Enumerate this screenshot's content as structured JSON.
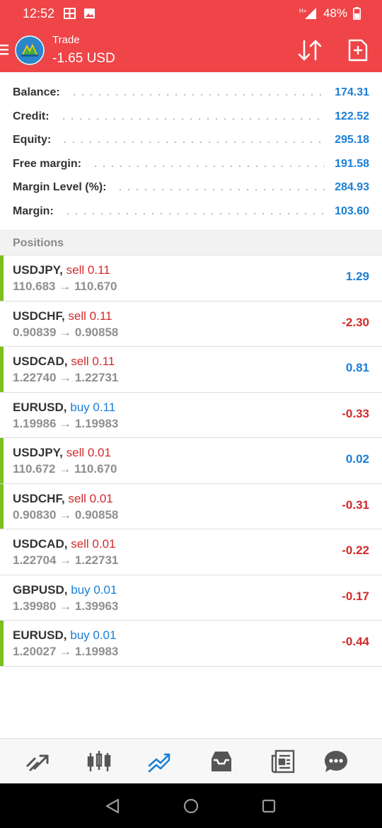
{
  "status_bar": {
    "time": "12:52",
    "network": "H+",
    "battery": "48%"
  },
  "app_bar": {
    "title": "Trade",
    "profit": "-1.65 USD"
  },
  "account": [
    {
      "label": "Balance:",
      "value": "174.31"
    },
    {
      "label": "Credit:",
      "value": "122.52"
    },
    {
      "label": "Equity:",
      "value": "295.18"
    },
    {
      "label": "Free margin:",
      "value": "191.58"
    },
    {
      "label": "Margin Level (%):",
      "value": "284.93"
    },
    {
      "label": "Margin:",
      "value": "103.60"
    }
  ],
  "positions_header": "Positions",
  "positions": [
    {
      "symbol": "USDJPY,",
      "side": "sell 0.11",
      "prices": "110.683 → 110.670",
      "profit": "1.29"
    },
    {
      "symbol": "USDCHF,",
      "side": "sell 0.11",
      "prices": "0.90839 → 0.90858",
      "profit": "-2.30"
    },
    {
      "symbol": "USDCAD,",
      "side": "sell 0.11",
      "prices": "1.22740 → 1.22731",
      "profit": "0.81"
    },
    {
      "symbol": "EURUSD,",
      "side": "buy 0.11",
      "prices": "1.19986 → 1.19983",
      "profit": "-0.33"
    },
    {
      "symbol": "USDJPY,",
      "side": "sell 0.01",
      "prices": "110.672 → 110.670",
      "profit": "0.02"
    },
    {
      "symbol": "USDCHF,",
      "side": "sell 0.01",
      "prices": "0.90830 → 0.90858",
      "profit": "-0.31"
    },
    {
      "symbol": "USDCAD,",
      "side": "sell 0.01",
      "prices": "1.22704 → 1.22731",
      "profit": "-0.22"
    },
    {
      "symbol": "GBPUSD,",
      "side": "buy 0.01",
      "prices": "1.39980 → 1.39963",
      "profit": "-0.17"
    },
    {
      "symbol": "EURUSD,",
      "side": "buy 0.01",
      "prices": "1.20027 → 1.19983",
      "profit": "-0.44"
    }
  ],
  "colors": {
    "header": "#ef4548",
    "profit_positive": "#1a7fd6",
    "profit_negative": "#d32a2a",
    "sell": "#d32a2a",
    "buy": "#1a7fd6",
    "profit_bar": "#7bbf1e",
    "nav_active": "#1a7fd6"
  },
  "bottom_nav": [
    {
      "icon": "quotes-icon",
      "active": false
    },
    {
      "icon": "chart-icon",
      "active": false
    },
    {
      "icon": "trade-icon",
      "active": true
    },
    {
      "icon": "history-icon",
      "active": false
    },
    {
      "icon": "news-icon",
      "active": false
    },
    {
      "icon": "messages-icon",
      "active": false
    }
  ]
}
